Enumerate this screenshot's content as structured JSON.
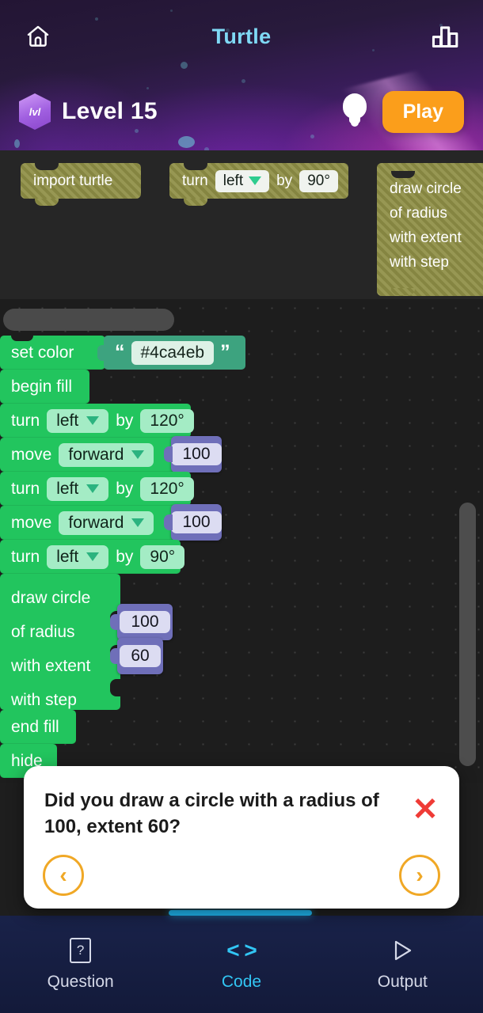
{
  "header": {
    "home_icon": "home-icon",
    "title": "Turtle",
    "stats_icon": "bar-chart-icon",
    "level_badge_text": "lvl",
    "level_label": "Level 15",
    "hint_icon": "lightbulb-icon",
    "play_label": "Play",
    "accent_title_color": "#7fd9f5",
    "play_button_color": "#fb9e1b"
  },
  "palette": {
    "blocks": [
      {
        "label": "import turtle"
      },
      {
        "label": "turn",
        "dropdown": "left",
        "connector": "by",
        "value": "90°"
      },
      {
        "lines": [
          "draw circle",
          "of radius",
          "with extent",
          "with step"
        ]
      }
    ]
  },
  "workspace": {
    "blocks": [
      {
        "label": "set color",
        "string_value": "#4ca4eb",
        "quote_open": "“",
        "quote_close": "”"
      },
      {
        "label": "begin fill"
      },
      {
        "label": "turn",
        "dropdown": "left",
        "connector": "by",
        "value": "120°"
      },
      {
        "label": "move",
        "dropdown": "forward",
        "number": "100"
      },
      {
        "label": "turn",
        "dropdown": "left",
        "connector": "by",
        "value": "120°"
      },
      {
        "label": "move",
        "dropdown": "forward",
        "number": "100"
      },
      {
        "label": "turn",
        "dropdown": "left",
        "connector": "by",
        "value": "90°"
      },
      {
        "lines": [
          "draw circle",
          "of radius",
          "with extent",
          "with step"
        ],
        "radius": "100",
        "extent": "60",
        "step": ""
      },
      {
        "label": "end fill"
      },
      {
        "label": "hide"
      }
    ],
    "block_color": "#22c55e",
    "string_block_color": "#3da37f",
    "number_block_color": "#6f6fb9"
  },
  "question_card": {
    "text": "Did you draw a circle with a radius of 100, extent 60?",
    "close_icon": "close-x-icon",
    "prev_icon": "chevron-left-icon",
    "next_icon": "chevron-right-icon",
    "prev_label": "‹",
    "next_label": "›",
    "close_label": "✕",
    "accent_color": "#f0a826",
    "close_color": "#ef3b36"
  },
  "bottom_nav": {
    "items": [
      {
        "label": "Question",
        "icon": "question-book-icon",
        "active": false
      },
      {
        "label": "Code",
        "icon": "code-brackets-icon",
        "active": true
      },
      {
        "label": "Output",
        "icon": "play-triangle-icon",
        "active": false
      }
    ],
    "active_color": "#32c6f4",
    "inactive_color": "#d5d9e8"
  }
}
